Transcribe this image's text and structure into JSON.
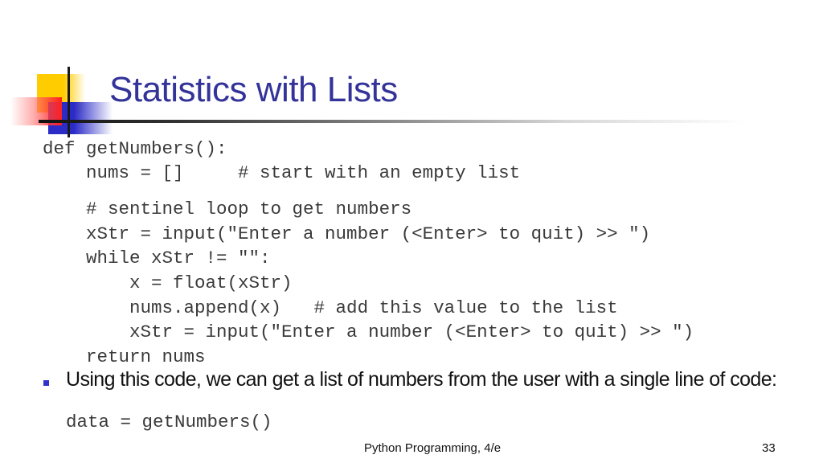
{
  "slide": {
    "title": "Statistics with Lists",
    "code_lines": [
      "def getNumbers():",
      "    nums = []     # start with an empty list",
      "    # sentinel loop to get numbers",
      "    xStr = input(\"Enter a number (<Enter> to quit) >> \")",
      "    while xStr != \"\":",
      "        x = float(xStr)",
      "        nums.append(x)   # add this value to the list",
      "        xStr = input(\"Enter a number (<Enter> to quit) >> \")",
      "    return nums"
    ],
    "bullet": {
      "text": "Using this code, we can get a list of numbers from the user with a single line of code:",
      "code": "data = getNumbers()"
    }
  },
  "footer": {
    "title": "Python Programming, 4/e",
    "page_number": "33"
  },
  "colors": {
    "title": "#333399",
    "bullet": "#3333cc",
    "deco_yellow": "#ffcc00",
    "deco_blue": "#2b2bc8",
    "deco_red": "#ff2020"
  }
}
